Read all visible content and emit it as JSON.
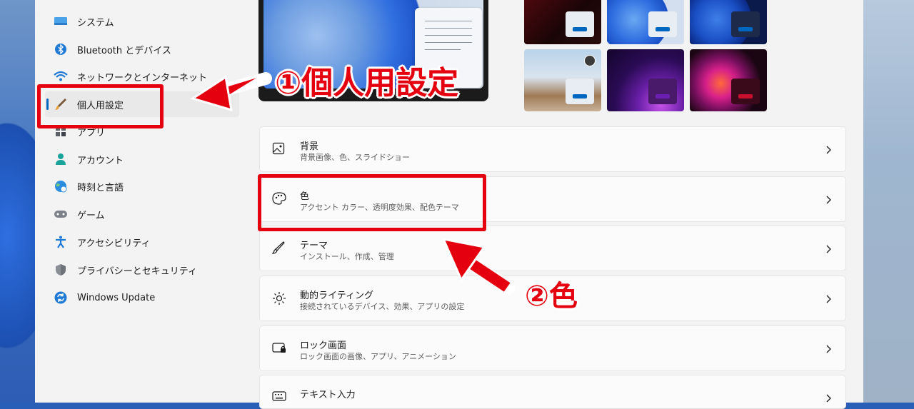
{
  "sidebar": {
    "items": [
      {
        "label": "システム",
        "icon": "monitor-icon"
      },
      {
        "label": "Bluetooth とデバイス",
        "icon": "bluetooth-icon"
      },
      {
        "label": "ネットワークとインターネット",
        "icon": "wifi-icon"
      },
      {
        "label": "個人用設定",
        "icon": "paintbrush-icon",
        "selected": true
      },
      {
        "label": "アプリ",
        "icon": "apps-icon"
      },
      {
        "label": "アカウント",
        "icon": "person-icon"
      },
      {
        "label": "時刻と言語",
        "icon": "globe-clock-icon"
      },
      {
        "label": "ゲーム",
        "icon": "gamepad-icon"
      },
      {
        "label": "アクセシビリティ",
        "icon": "accessibility-icon"
      },
      {
        "label": "プライバシーとセキュリティ",
        "icon": "shield-icon"
      },
      {
        "label": "Windows Update",
        "icon": "sync-icon"
      }
    ]
  },
  "cards": [
    {
      "title": "背景",
      "subtitle": "背景画像、色、スライドショー",
      "icon": "image-icon"
    },
    {
      "title": "色",
      "subtitle": "アクセント カラー、透明度効果、配色テーマ",
      "icon": "palette-icon"
    },
    {
      "title": "テーマ",
      "subtitle": "インストール、作成、管理",
      "icon": "brush-icon"
    },
    {
      "title": "動的ライティング",
      "subtitle": "接続されているデバイス、効果、アプリの設定",
      "icon": "lighting-icon"
    },
    {
      "title": "ロック画面",
      "subtitle": "ロック画面の画像、アプリ、アニメーション",
      "icon": "lock-screen-icon"
    },
    {
      "title": "テキスト入力",
      "subtitle": "",
      "icon": "keyboard-icon"
    }
  ],
  "annotations": {
    "step1": "①個人用設定",
    "step2": "②色"
  },
  "colors": {
    "accent": "#0067c0",
    "annotation_red": "#e4000f"
  }
}
